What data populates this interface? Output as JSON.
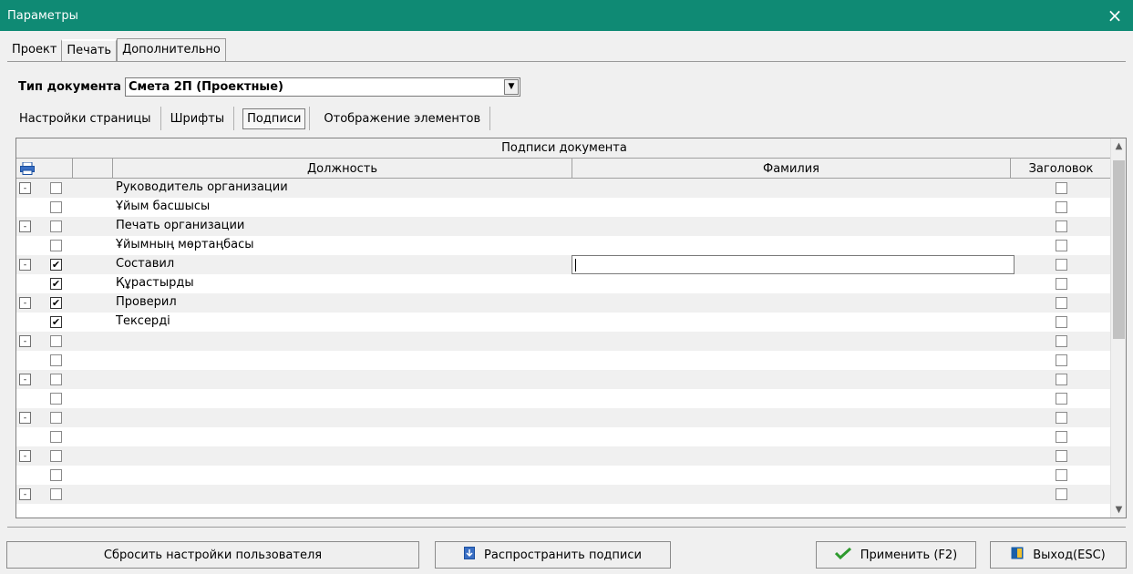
{
  "window": {
    "title": "Параметры",
    "close_icon": "×"
  },
  "main_tabs": [
    {
      "label": "Проект"
    },
    {
      "label": "Печать"
    },
    {
      "label": "Дополнительно"
    }
  ],
  "doc_type": {
    "label": "Тип документа",
    "value": "Смета 2П (Проектные)"
  },
  "sub_tabs": [
    {
      "label": "Настройки страницы"
    },
    {
      "label": "Шрифты"
    },
    {
      "label": "Подписи"
    },
    {
      "label": "Отображение элементов"
    }
  ],
  "grid": {
    "caption": "Подписи документа",
    "columns": {
      "position": "Должность",
      "surname": "Фамилия",
      "header": "Заголовок"
    },
    "rows": [
      {
        "expander": "-",
        "checked": false,
        "position": "Руководитель организации"
      },
      {
        "expander": "",
        "checked": false,
        "position": "Ұйым басшысы"
      },
      {
        "expander": "-",
        "checked": false,
        "position": "Печать организации"
      },
      {
        "expander": "",
        "checked": false,
        "position": "Ұйымның мөртаңбасы"
      },
      {
        "expander": "-",
        "checked": true,
        "position": "Составил"
      },
      {
        "expander": "",
        "checked": true,
        "position": "Құрастырды"
      },
      {
        "expander": "-",
        "checked": true,
        "position": "Проверил"
      },
      {
        "expander": "",
        "checked": true,
        "position": "Тексерді"
      },
      {
        "expander": "-",
        "checked": false,
        "position": ""
      },
      {
        "expander": "",
        "checked": false,
        "position": ""
      },
      {
        "expander": "-",
        "checked": false,
        "position": ""
      },
      {
        "expander": "",
        "checked": false,
        "position": ""
      },
      {
        "expander": "-",
        "checked": false,
        "position": ""
      },
      {
        "expander": "",
        "checked": false,
        "position": ""
      },
      {
        "expander": "-",
        "checked": false,
        "position": ""
      },
      {
        "expander": "",
        "checked": false,
        "position": ""
      },
      {
        "expander": "-",
        "checked": false,
        "position": ""
      }
    ]
  },
  "buttons": {
    "reset": "Сбросить настройки пользователя",
    "spread": "Распространить подписи",
    "apply": "Применить (F2)",
    "exit": "Выход(ESC)"
  },
  "colors": {
    "titlebar": "#0f8a74",
    "apply_icon": "#2e9a2e",
    "spread_icon": "#3a6fc4",
    "exit_icon": "#1a5fa8"
  }
}
